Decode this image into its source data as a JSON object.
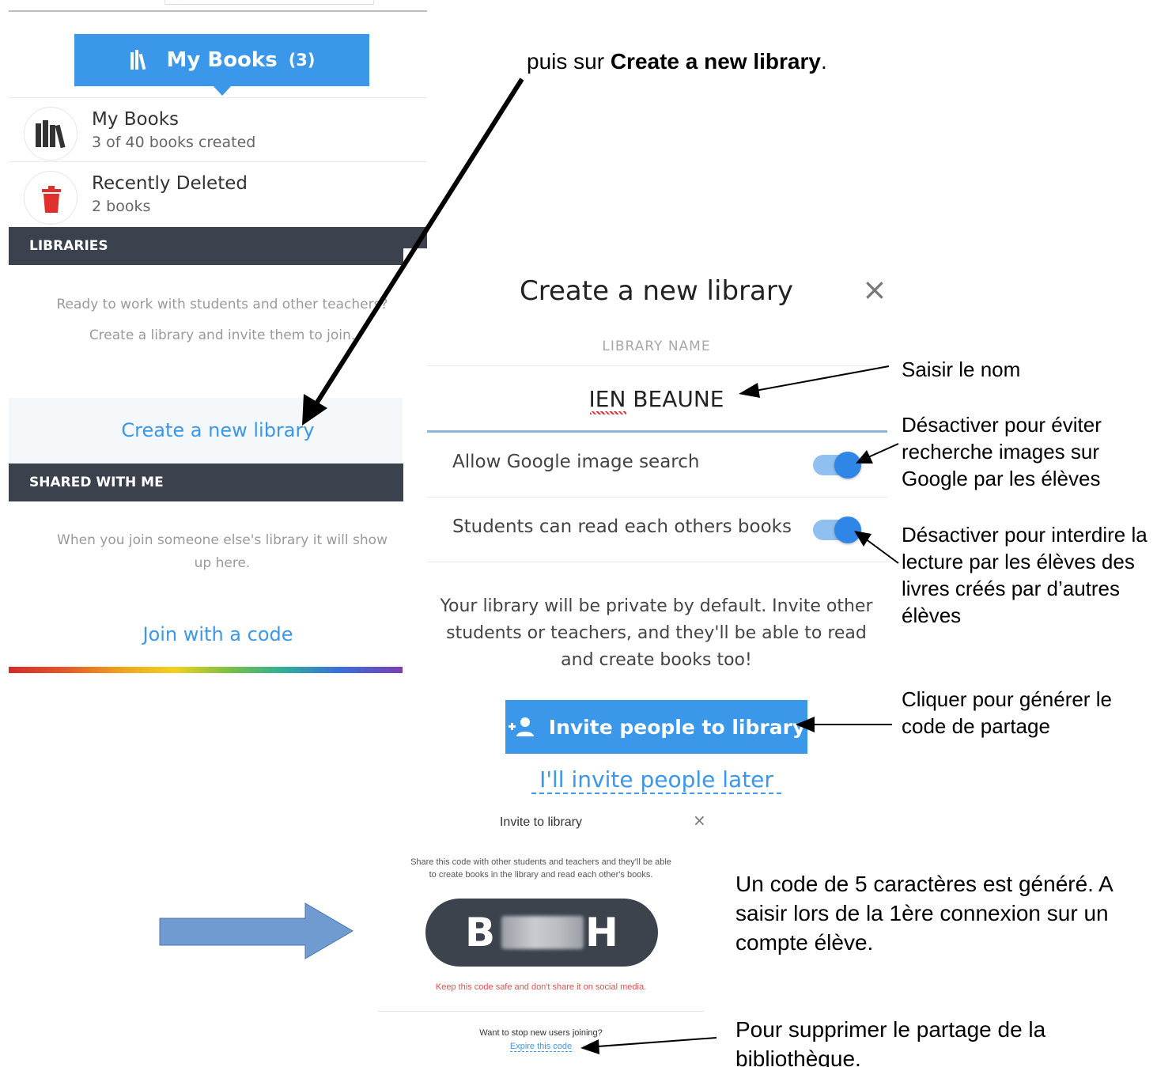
{
  "left_panel": {
    "tab_label": "My Books",
    "tab_count": "(3)",
    "rows": [
      {
        "title": "My Books",
        "subtitle": "3 of 40 books created"
      },
      {
        "title": "Recently Deleted",
        "subtitle": "2 books"
      }
    ],
    "libraries_header": "LIBRARIES",
    "libraries_note_1": "Ready to work with students and other teachers?",
    "libraries_note_2": "Create a library and invite them to join.",
    "create_link": "Create a new library",
    "shared_header": "SHARED WITH ME",
    "shared_note": "When you join someone else's library it will show up here.",
    "join_link": "Join with a code"
  },
  "dialog": {
    "title": "Create a new library",
    "close_symbol": "×",
    "name_label": "LIBRARY NAME",
    "name_value": "IEN BEAUNE",
    "toggles": [
      {
        "label": "Allow Google image search",
        "on": true
      },
      {
        "label": "Students can read each others books",
        "on": true
      }
    ],
    "private_text": "Your library will be private by default. Invite other students or teachers, and they'll be able to read and create books too!",
    "invite_button": "Invite people to library",
    "later_link": "I'll invite people later"
  },
  "invite_modal": {
    "title": "Invite to library",
    "close_symbol": "×",
    "description": "Share this code with other students and teachers and they'll be able to create books in the library and read each other's books.",
    "code_first": "B",
    "code_last": "H",
    "warning": "Keep this code safe and don't share it on social media.",
    "stop_text": "Want to stop new users joining?",
    "expire_link": "Expire this code"
  },
  "annotations": {
    "top_prefix": "puis sur ",
    "top_bold": "Create a new library",
    "top_suffix": ".",
    "name_note": "Saisir le nom",
    "google_note": "Désactiver pour éviter recherche images sur Google par les élèves",
    "read_note": "Désactiver pour interdire la lecture par les élèves des livres créés par d’autres élèves",
    "invite_note": "Cliquer pour générer le code de partage",
    "code_note": "Un code de 5 caractères est généré. A saisir lors de la 1ère connexion sur un compte élève.",
    "expire_note": "Pour supprimer le partage de la bibliothèque."
  },
  "colors": {
    "accent": "#3b97ea",
    "dark_bar": "#3b424d",
    "warning": "#e05050",
    "trash": "#e0302e",
    "arrow_fill": "#6f9bd1"
  }
}
